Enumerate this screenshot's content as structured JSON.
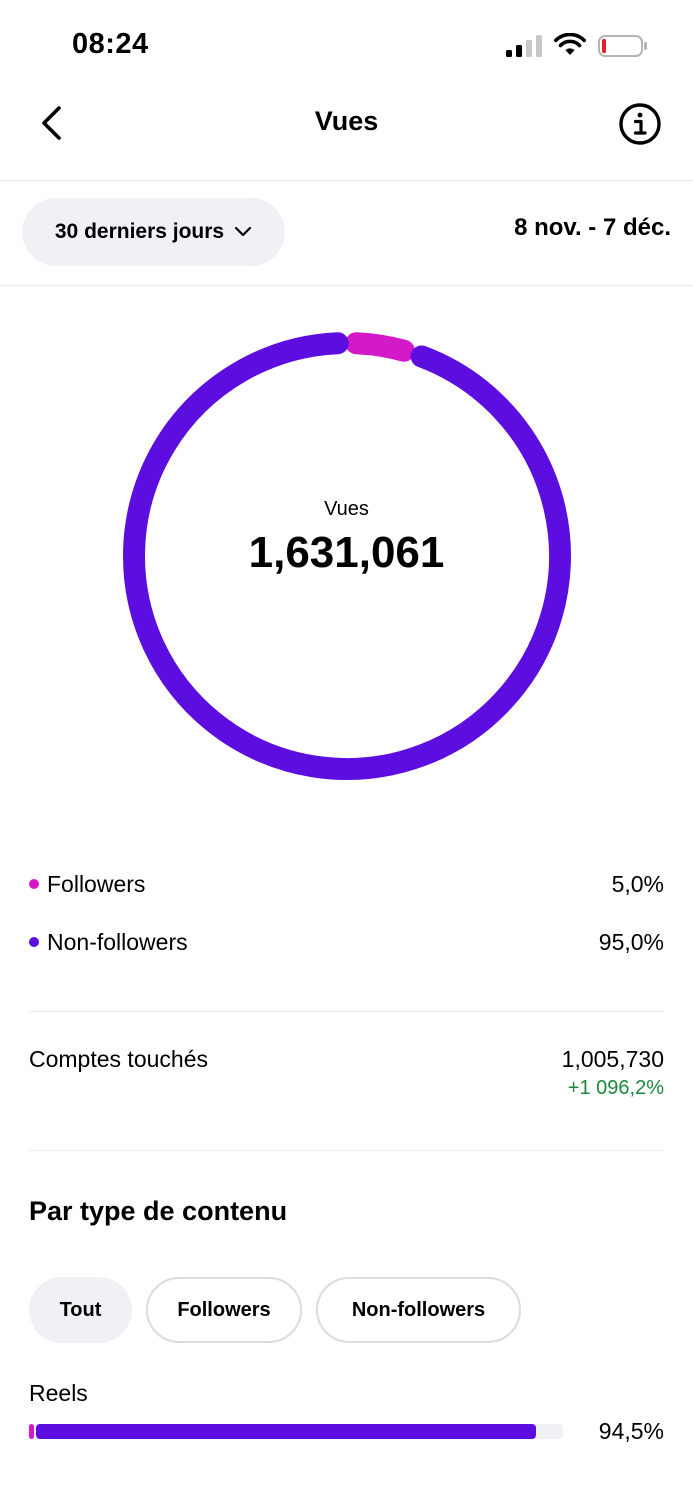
{
  "status_bar": {
    "time": "08:24"
  },
  "header": {
    "title": "Vues"
  },
  "filter": {
    "range_label": "30 derniers jours",
    "dates": "8 nov. - 7 déc."
  },
  "summary": {
    "label": "Vues",
    "total": "1,631,061"
  },
  "colors": {
    "followers": "#d41ac8",
    "non_followers": "#5c0de0",
    "positive": "#1a8a3a"
  },
  "chart_data": {
    "type": "pie",
    "variant": "donut",
    "center_label": "Vues",
    "center_value": 1631061,
    "slices": [
      {
        "name": "Followers",
        "value": 5.0
      },
      {
        "name": "Non-followers",
        "value": 95.0
      }
    ]
  },
  "legend": [
    {
      "label": "Followers",
      "value": "5,0%"
    },
    {
      "label": "Non-followers",
      "value": "95,0%"
    }
  ],
  "accounts_reached": {
    "label": "Comptes touchés",
    "value": "1,005,730",
    "change": "+1 096,2%"
  },
  "content_type": {
    "title": "Par type de contenu",
    "tabs": [
      {
        "label": "Tout",
        "active": true
      },
      {
        "label": "Followers",
        "active": false
      },
      {
        "label": "Non-followers",
        "active": false
      }
    ],
    "rows": [
      {
        "label": "Reels",
        "percent": "94,5%",
        "followers_share": 1.0,
        "non_followers_share": 93.5
      }
    ]
  }
}
